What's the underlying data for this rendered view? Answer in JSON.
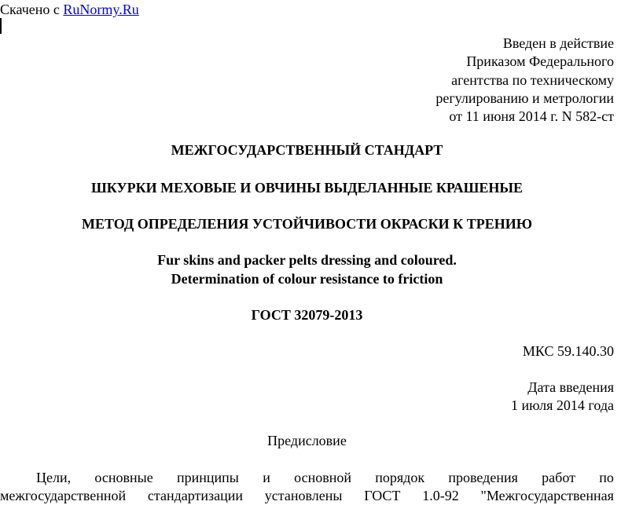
{
  "source": {
    "prefix": "Скачено с",
    "link_text": "RuNormy.Ru"
  },
  "adoption": {
    "lines": [
      "Введен в действие",
      "Приказом Федерального",
      "агентства по техническому",
      "регулированию и метрологии",
      "от 11 июня 2014 г. N 582-ст"
    ]
  },
  "header": {
    "standard_type": "МЕЖГОСУДАРСТВЕННЫЙ СТАНДАРТ",
    "title_ru_1": "ШКУРКИ МЕХОВЫЕ И ОВЧИНЫ ВЫДЕЛАННЫЕ КРАШЕНЫЕ",
    "title_ru_2": "МЕТОД ОПРЕДЕЛЕНИЯ УСТОЙЧИВОСТИ ОКРАСКИ К ТРЕНИЮ",
    "title_en_1": "Fur skins and packer pelts dressing and coloured.",
    "title_en_2": "Determination of colour resistance to friction",
    "gost_code": "ГОСТ 32079-2013"
  },
  "meta": {
    "mks": "МКС 59.140.30",
    "intro_date_label": "Дата введения",
    "intro_date_value": "1 июля 2014 года"
  },
  "foreword": {
    "heading": "Предисловие",
    "line1_words": [
      "Цели,",
      "основные",
      "принципы",
      "и",
      "основной",
      "порядок",
      "проведения",
      "работ",
      "по"
    ],
    "line2_words": [
      "межгосударственной",
      "стандартизации",
      "установлены",
      "ГОСТ",
      "1.0-92",
      "\"Межгосударственная"
    ]
  }
}
